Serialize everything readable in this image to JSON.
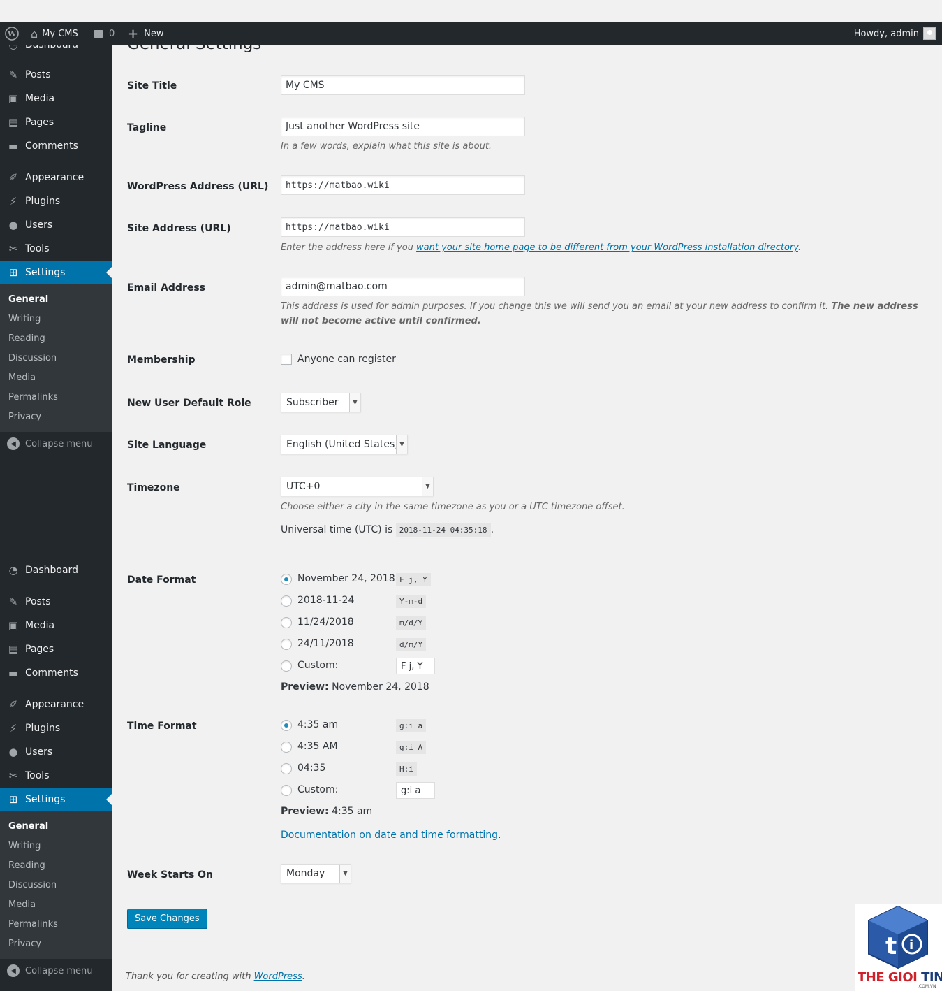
{
  "adminbar": {
    "site_name": "My CMS",
    "comments_count": "0",
    "new_label": "New",
    "howdy": "Howdy, admin"
  },
  "sidebar": {
    "partial_top_label": "Dashboard",
    "items_a": [
      {
        "label": "Posts",
        "icon": "pin-icon"
      },
      {
        "label": "Media",
        "icon": "media-icon"
      },
      {
        "label": "Pages",
        "icon": "pages-icon"
      },
      {
        "label": "Comments",
        "icon": "comments-icon"
      },
      {
        "label": "Appearance",
        "icon": "appearance-icon"
      },
      {
        "label": "Plugins",
        "icon": "plugins-icon"
      },
      {
        "label": "Users",
        "icon": "users-icon"
      },
      {
        "label": "Tools",
        "icon": "tools-icon"
      },
      {
        "label": "Settings",
        "icon": "settings-icon"
      }
    ],
    "submenu": [
      "General",
      "Writing",
      "Reading",
      "Discussion",
      "Media",
      "Permalinks",
      "Privacy"
    ],
    "collapse_label": "Collapse menu",
    "items_b": [
      {
        "label": "Dashboard",
        "icon": "dashboard-icon"
      },
      {
        "label": "Posts",
        "icon": "pin-icon"
      },
      {
        "label": "Media",
        "icon": "media-icon"
      },
      {
        "label": "Pages",
        "icon": "pages-icon"
      },
      {
        "label": "Comments",
        "icon": "comments-icon"
      },
      {
        "label": "Appearance",
        "icon": "appearance-icon"
      },
      {
        "label": "Plugins",
        "icon": "plugins-icon"
      },
      {
        "label": "Users",
        "icon": "users-icon"
      },
      {
        "label": "Tools",
        "icon": "tools-icon"
      },
      {
        "label": "Settings",
        "icon": "settings-icon"
      }
    ]
  },
  "page": {
    "title": "General Settings",
    "site_title": {
      "label": "Site Title",
      "value": "My CMS"
    },
    "tagline": {
      "label": "Tagline",
      "value": "Just another WordPress site",
      "desc": "In a few words, explain what this site is about."
    },
    "wp_address": {
      "label": "WordPress Address (URL)",
      "value": "https://matbao.wiki"
    },
    "site_address": {
      "label": "Site Address (URL)",
      "value": "https://matbao.wiki",
      "desc_pre": "Enter the address here if you ",
      "desc_link": "want your site home page to be different from your WordPress installation directory",
      "desc_post": "."
    },
    "email": {
      "label": "Email Address",
      "value": "admin@matbao.com",
      "desc_pre": "This address is used for admin purposes. If you change this we will send you an email at your new address to confirm it. ",
      "desc_bold": "The new address will not become active until confirmed."
    },
    "membership": {
      "label": "Membership",
      "checkbox_label": "Anyone can register"
    },
    "default_role": {
      "label": "New User Default Role",
      "value": "Subscriber"
    },
    "language": {
      "label": "Site Language",
      "value": "English (United States)"
    },
    "timezone": {
      "label": "Timezone",
      "value": "UTC+0",
      "desc": "Choose either a city in the same timezone as you or a UTC timezone offset.",
      "utc_pre": "Universal time (UTC) is ",
      "utc_value": "2018-11-24 04:35:18",
      "utc_post": "."
    },
    "date_format": {
      "label": "Date Format",
      "options": [
        {
          "label": "November 24, 2018",
          "code": "F j, Y"
        },
        {
          "label": "2018-11-24",
          "code": "Y-m-d"
        },
        {
          "label": "11/24/2018",
          "code": "m/d/Y"
        },
        {
          "label": "24/11/2018",
          "code": "d/m/Y"
        }
      ],
      "custom_label": "Custom:",
      "custom_value": "F j, Y",
      "preview_label": "Preview:",
      "preview_value": "November 24, 2018"
    },
    "time_format": {
      "label": "Time Format",
      "options": [
        {
          "label": "4:35 am",
          "code": "g:i a"
        },
        {
          "label": "4:35 AM",
          "code": "g:i A"
        },
        {
          "label": "04:35",
          "code": "H:i"
        }
      ],
      "custom_label": "Custom:",
      "custom_value": "g:i a",
      "preview_label": "Preview:",
      "preview_value": "4:35 am",
      "doc_link": "Documentation on date and time formatting",
      "doc_post": "."
    },
    "week_start": {
      "label": "Week Starts On",
      "value": "Monday"
    },
    "save_button": "Save Changes",
    "footer_pre": "Thank you for creating with ",
    "footer_link": "WordPress",
    "footer_post": "."
  },
  "watermark": {
    "text_a": "THE GIOI ",
    "text_b": "TINHOC",
    "sub": ".COM.VN"
  },
  "colors": {
    "accent": "#0073aa",
    "sidebar_bg": "#23282d",
    "submenu_bg": "#32373c",
    "button": "#0085ba"
  }
}
